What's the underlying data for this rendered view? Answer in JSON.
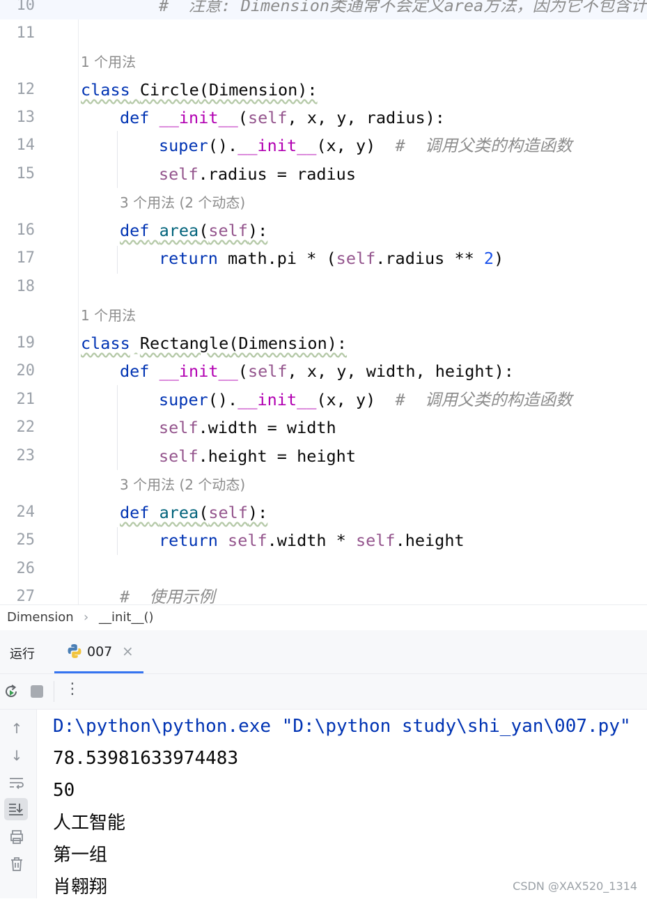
{
  "editor": {
    "lines": [
      {
        "n": "10",
        "comment": "#  注意: Dimension类通常不会定义area方法，因为它不包含计算"
      },
      {
        "n": "11"
      },
      {
        "hint": "1 个用法"
      },
      {
        "n": "12",
        "kw": "class",
        "name": "Circle",
        "rest": "(Dimension):"
      },
      {
        "n": "13",
        "def": "def",
        "func": "__init__",
        "open": "(",
        "self": "self",
        "args": ", x, y, radius):"
      },
      {
        "n": "14",
        "super": "super",
        "mid": "().",
        "dunder": "__init__",
        "args": "(x, y)",
        "comment": "#  调用父类的构造函数"
      },
      {
        "n": "15",
        "self": "self",
        "rest": ".radius = radius"
      },
      {
        "hint": "3 个用法 (2 个动态)"
      },
      {
        "n": "16",
        "def": "def",
        "func": "area",
        "open": "(",
        "self": "self",
        "close": "):"
      },
      {
        "n": "17",
        "kw": "return",
        "a": " math.pi * (",
        "self": "self",
        "b": ".radius ** ",
        "num": "2",
        "c": ")"
      },
      {
        "n": "18"
      },
      {
        "hint": "1 个用法"
      },
      {
        "n": "19",
        "kw": "class",
        "name": "Rectangle",
        "rest": "(Dimension):"
      },
      {
        "n": "20",
        "def": "def",
        "func": "__init__",
        "open": "(",
        "self": "self",
        "args": ", x, y, width, height):"
      },
      {
        "n": "21",
        "super": "super",
        "mid": "().",
        "dunder": "__init__",
        "args": "(x, y)",
        "comment": "#  调用父类的构造函数"
      },
      {
        "n": "22",
        "self": "self",
        "rest": ".width = width"
      },
      {
        "n": "23",
        "self": "self",
        "rest": ".height = height"
      },
      {
        "hint": "3 个用法 (2 个动态)"
      },
      {
        "n": "24",
        "def": "def",
        "func": "area",
        "open": "(",
        "self": "self",
        "close": "):"
      },
      {
        "n": "25",
        "kw": "return",
        "sp": " ",
        "self": "self",
        "a": ".width * ",
        "self2": "self",
        "b": ".height"
      },
      {
        "n": "26"
      },
      {
        "n": "27",
        "comment": "#  使用示例"
      }
    ]
  },
  "breadcrumb": {
    "item1": "Dimension",
    "sep": "›",
    "item2": "__init__()"
  },
  "run": {
    "label": "运行",
    "tab": "007",
    "close": "×",
    "menu": "⋮",
    "output": [
      "D:\\python\\python.exe \"D:\\python study\\shi_yan\\007.py\"",
      "78.53981633974483",
      "50",
      "人工智能",
      "第一组",
      "肖翱翔"
    ]
  },
  "watermark": "CSDN @XAX520_1314",
  "colors": {
    "keyword": "#0033b3",
    "self": "#94558d",
    "dunder": "#b200b2",
    "number": "#1750eb",
    "comment": "#8c8c8c"
  }
}
